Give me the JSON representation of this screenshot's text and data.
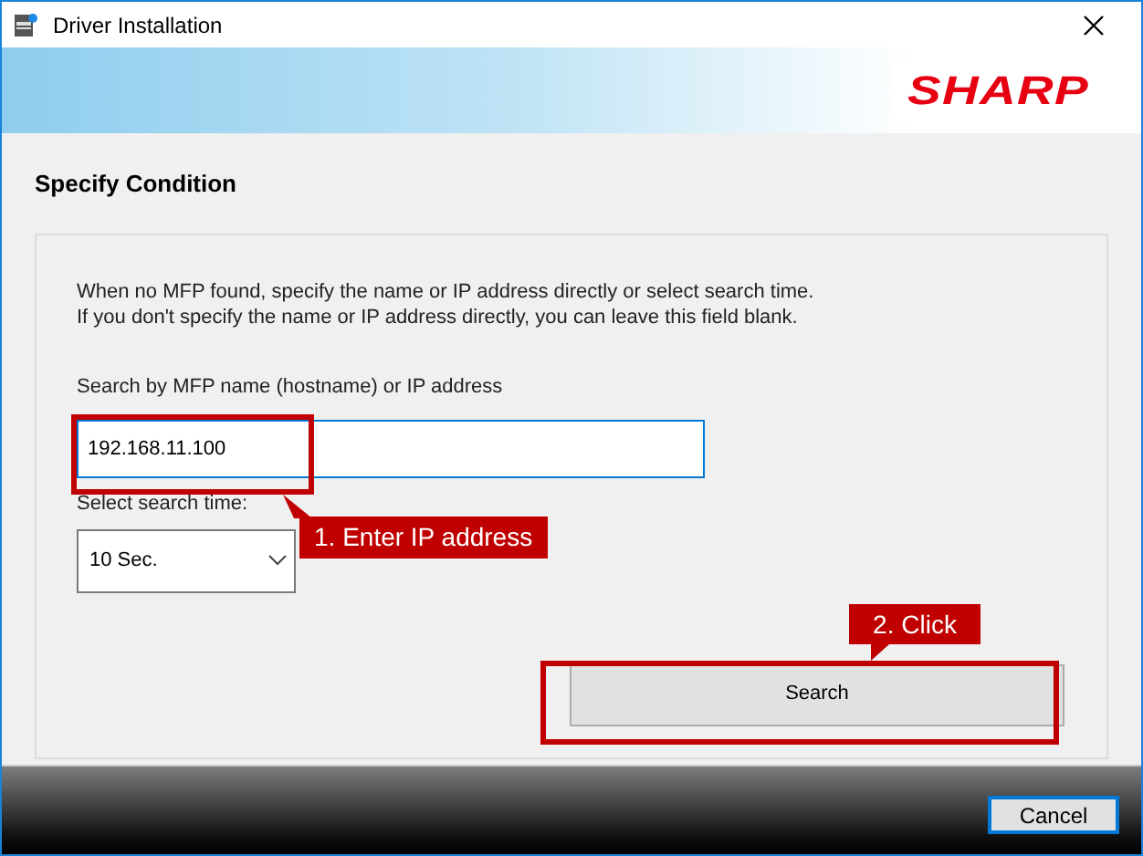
{
  "window": {
    "title": "Driver Installation"
  },
  "banner": {
    "logo": "SHARP"
  },
  "page": {
    "heading": "Specify Condition"
  },
  "panel": {
    "description_lines": [
      "When no MFP found, specify the name or IP address directly or select search time.",
      "If you don't specify the name or IP address directly, you can leave this field blank."
    ]
  },
  "host_field": {
    "label": "Search by MFP name (hostname) or IP address",
    "value": "192.168.11.100",
    "focused": true
  },
  "search_time": {
    "label": "Select search time:",
    "value": "10 Sec."
  },
  "search_button": {
    "label": "Search"
  },
  "callouts": [
    {
      "text": "1. Enter IP address"
    },
    {
      "text": "2. Click"
    }
  ],
  "footer": {
    "buttons": [
      {
        "label": "Cancel",
        "default": true
      }
    ]
  }
}
